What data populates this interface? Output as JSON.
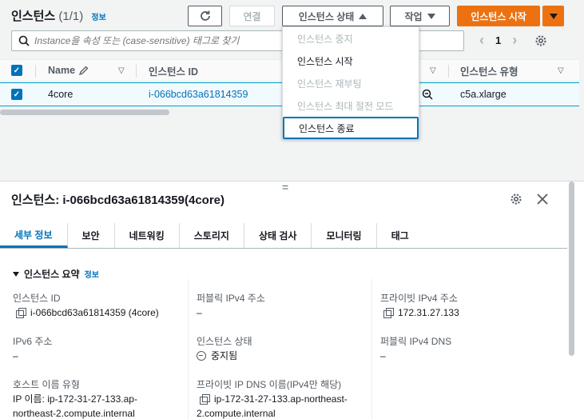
{
  "header": {
    "title": "인스턴스",
    "count": "(1/1)",
    "info_link": "정보"
  },
  "toolbar": {
    "refresh_icon": "refresh-icon",
    "connect_label": "연결",
    "instance_state_label": "인스턴스 상태",
    "actions_label": "작업",
    "launch_label": "인스턴스 시작"
  },
  "search": {
    "placeholder": "Instance을 속성 또는 (case-sensitive) 태그로 찾기"
  },
  "pager": {
    "page": "1"
  },
  "table": {
    "headers": [
      "Name",
      "인스턴스 ID",
      "인스턴스 유형"
    ],
    "rows": [
      {
        "name": "4core",
        "id": "i-066bcd63a61814359",
        "type": "c5a.xlarge"
      }
    ]
  },
  "state_menu": {
    "items": [
      {
        "label": "인스턴스 중지",
        "enabled": false
      },
      {
        "label": "인스턴스 시작",
        "enabled": true
      },
      {
        "label": "인스턴스 재부팅",
        "enabled": false
      },
      {
        "label": "인스턴스 최대 절전 모드",
        "enabled": false
      },
      {
        "label": "인스턴스 종료",
        "enabled": true
      }
    ]
  },
  "details": {
    "divider_handle": "=",
    "title": "인스턴스: i-066bcd63a61814359(4core)",
    "tabs": [
      "세부 정보",
      "보안",
      "네트워킹",
      "스토리지",
      "상태 검사",
      "모니터링",
      "태그"
    ],
    "section_title": "인스턴스 요약",
    "section_info": "정보",
    "fields": {
      "instance_id_label": "인스턴스 ID",
      "instance_id_value": "i-066bcd63a61814359 (4core)",
      "public_ipv4_label": "퍼블릭 IPv4 주소",
      "public_ipv4_value": "–",
      "private_ipv4_label": "프라이빗 IPv4 주소",
      "private_ipv4_value": "172.31.27.133",
      "ipv6_label": "IPv6 주소",
      "ipv6_value": "–",
      "state_label": "인스턴스 상태",
      "state_value": "중지됨",
      "public_dns_label": "퍼블릭 IPv4 DNS",
      "public_dns_value": "–",
      "hostname_type_label": "호스트 이름 유형",
      "hostname_type_value_1": "IP 이름: ip-172-31-27-133.ap-",
      "hostname_type_value_2": "northeast-2.compute.internal",
      "private_dns_label": "프라이빗 IP DNS 이름(IPv4만 해당)",
      "private_dns_value_1": "ip-172-31-27-133.ap-northeast-",
      "private_dns_value_2": "2.compute.internal"
    }
  },
  "colors": {
    "accent": "#0073bb",
    "primary_button": "#ec7211"
  }
}
